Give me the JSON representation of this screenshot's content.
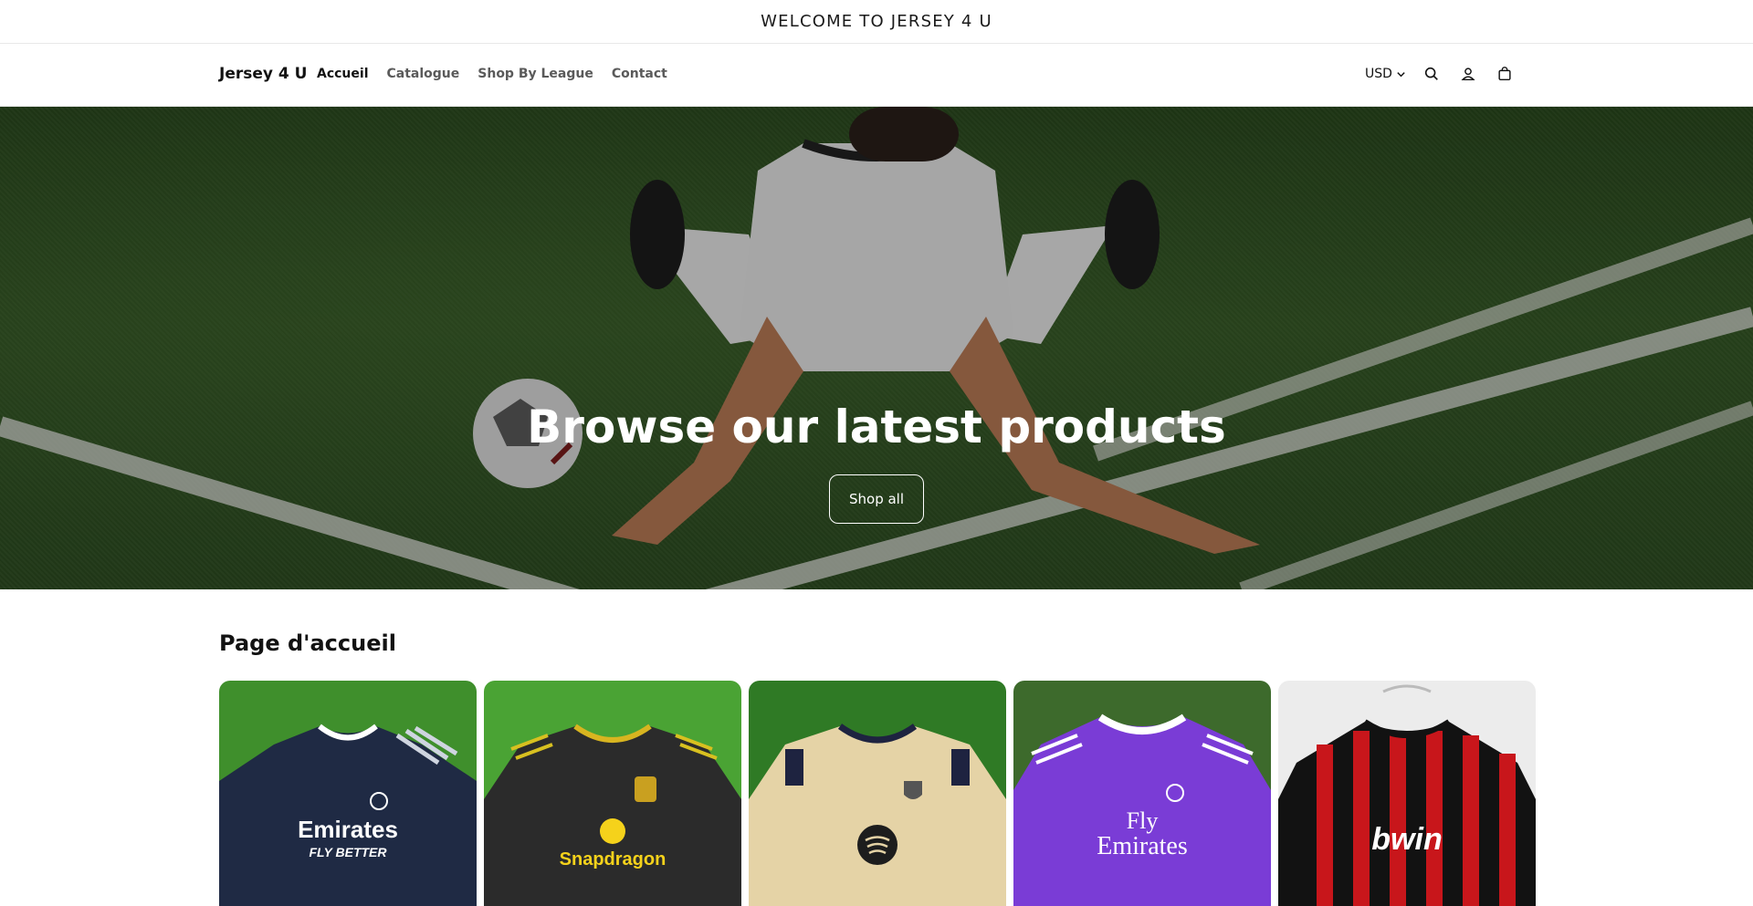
{
  "announcement": {
    "text": "WELCOME TO JERSEY 4 U"
  },
  "header": {
    "logo": "Jersey 4 U",
    "nav": [
      {
        "label": "Accueil",
        "active": true
      },
      {
        "label": "Catalogue",
        "active": false
      },
      {
        "label": "Shop By League",
        "active": false
      },
      {
        "label": "Contact",
        "active": false
      }
    ],
    "currency": "USD",
    "icons": [
      "search-icon",
      "account-icon",
      "cart-icon"
    ]
  },
  "hero": {
    "title": "Browse our latest products",
    "button_label": "Shop all"
  },
  "section": {
    "title": "Page d'accueil",
    "products": [
      {
        "sponsor": "Emirates",
        "tagline": "FLY BETTER",
        "color": "#1f2a44"
      },
      {
        "sponsor": "Snapdragon",
        "color": "#2b2b2b"
      },
      {
        "color": "#e5d3a6"
      },
      {
        "sponsor": "Fly",
        "sponsor2": "Emirates",
        "color": "#7a3cd6"
      },
      {
        "sponsor": "bwin",
        "color": "#c8161b"
      }
    ]
  },
  "colors": {
    "text": "#121212",
    "muted": "#5a5a5a",
    "border": "#e8e8e8",
    "grass": "#2e4f22"
  }
}
